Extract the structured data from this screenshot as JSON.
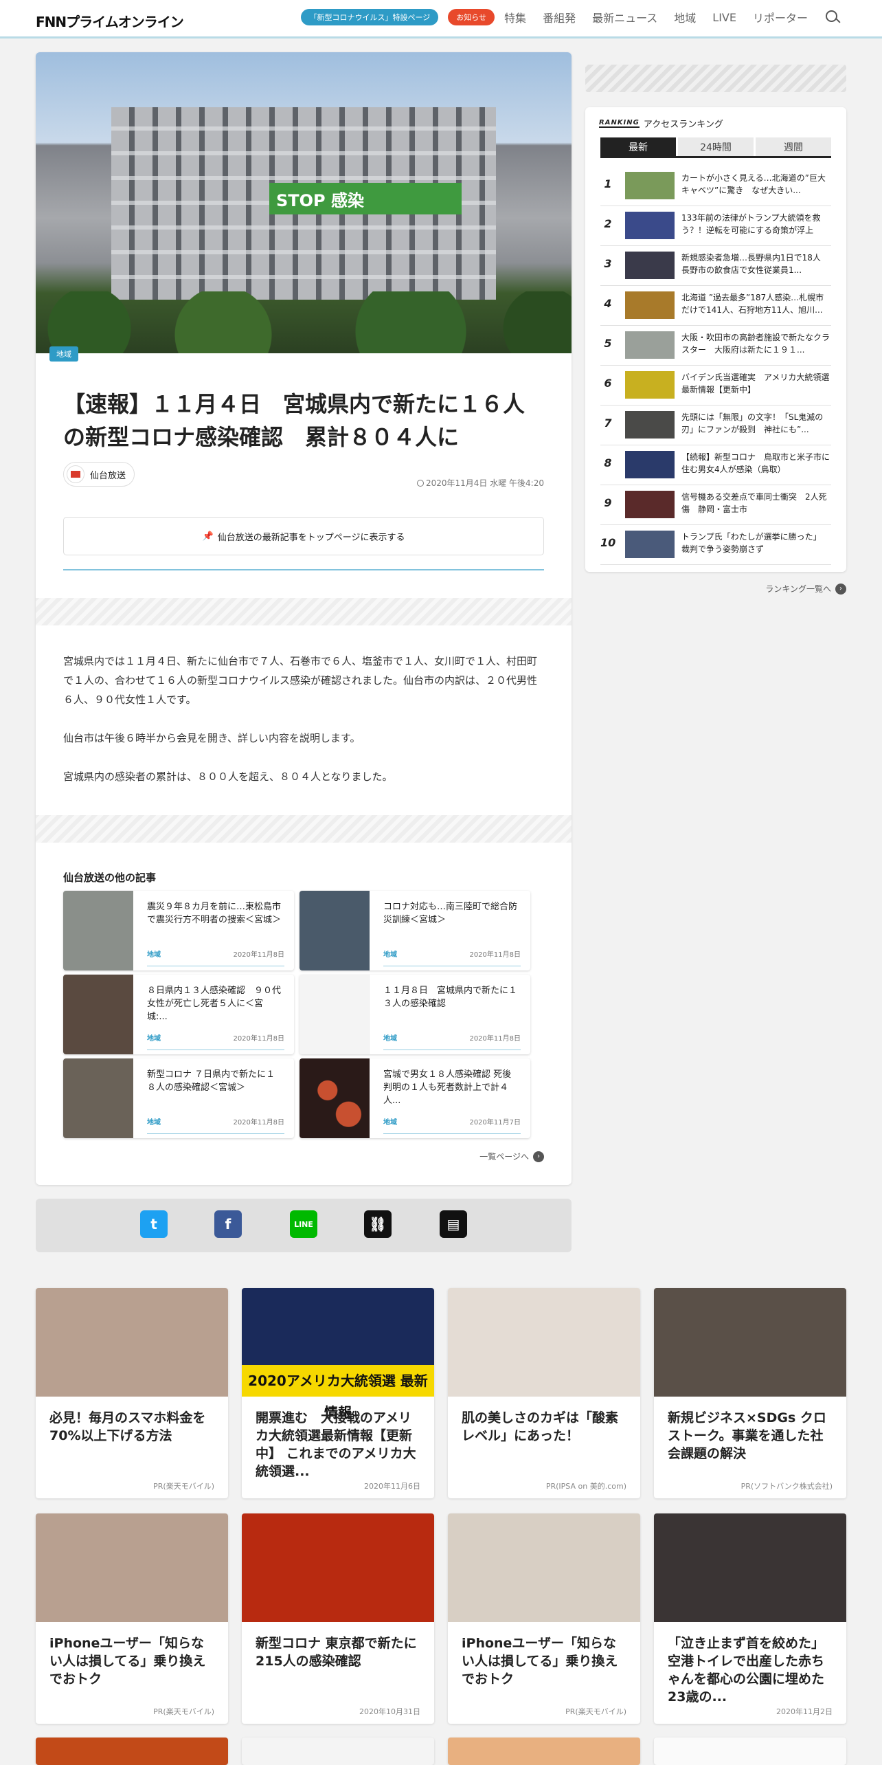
{
  "header": {
    "logo": "FNNプライムオンライン",
    "corona_pill": "「新型コロナウイルス」特設ページ",
    "notice_pill": "お知らせ",
    "nav": [
      "特集",
      "番組発",
      "最新ニュース",
      "地域",
      "LIVE",
      "リポーター"
    ]
  },
  "article": {
    "hero_banner": "STOP 感染",
    "category": "地域",
    "title": "【速報】１１月４日　宮城県内で新たに１６人の新型コロナ感染確認　累計８０４人に",
    "source": "仙台放送",
    "date": "2020年11月4日 水曜 午後4:20",
    "pin_label": "仙台放送の最新記事をトップページに表示する",
    "paragraphs": [
      "宮城県内では１１月４日、新たに仙台市で７人、石巻市で６人、塩釜市で１人、女川町で１人、村田町で１人の、合わせて１６人の新型コロナウイルス感染が確認されました。仙台市の内訳は、２０代男性６人、９０代女性１人です。",
      "仙台市は午後６時半から会見を開き、詳しい内容を説明します。",
      "宮城県内の感染者の累計は、８００人を超え、８０４人となりました。"
    ],
    "other_heading": "仙台放送の他の記事",
    "other_articles": [
      {
        "title": "震災９年８カ月を前に…東松島市で震災行方不明者の捜索＜宮城＞",
        "category": "地域",
        "date": "2020年11月8日",
        "color": "#8a8f8a"
      },
      {
        "title": "コロナ対応も…南三陸町で総合防災訓練＜宮城＞",
        "category": "地域",
        "date": "2020年11月8日",
        "color": "#4a5a6a"
      },
      {
        "title": "８日県内１３人感染確認　９０代女性が死亡し死者５人に＜宮城:...",
        "category": "地域",
        "date": "2020年11月8日",
        "color": "#5a4a40"
      },
      {
        "title": "１１月８日　宮城県内で新たに１３人の感染確認",
        "category": "地域",
        "date": "2020年11月8日",
        "color": "#ffffff"
      },
      {
        "title": "新型コロナ ７日県内で新たに１８人の感染確認＜宮城＞",
        "category": "地域",
        "date": "2020年11月8日",
        "color": "#6a6258"
      },
      {
        "title": "宮城で男女１８人感染確認 死後判明の１人も死者数計上で計４人...",
        "category": "地域",
        "date": "2020年11月7日",
        "color": "#2a1a18"
      }
    ],
    "more_label": "一覧ページへ"
  },
  "share": [
    "twitter-icon",
    "facebook-icon",
    "line-icon",
    "link-icon",
    "comment-icon"
  ],
  "ranking": {
    "brand": "RANKING",
    "title": "アクセスランキング",
    "tabs": [
      "最新",
      "24時間",
      "週間"
    ],
    "items": [
      {
        "rank": "1",
        "title": "カートが小さく見える…北海道の”巨大キャベツ”に驚き　なぜ大きい...",
        "color": "#7a9a5a"
      },
      {
        "rank": "2",
        "title": "133年前の法律がトランプ大統領を救う？！逆転を可能にする奇策が浮上",
        "color": "#3a4a8a"
      },
      {
        "rank": "3",
        "title": "新規感染者急増…長野県内1日で18人　長野市の飲食店で女性従業員1...",
        "color": "#3a3a4a"
      },
      {
        "rank": "4",
        "title": "北海道 ”過去最多”187人感染…札幌市だけで141人、石狩地方11人、旭川...",
        "color": "#a87a2a"
      },
      {
        "rank": "5",
        "title": "大阪・吹田市の高齢者施設で新たなクラスター　大阪府は新たに１９１...",
        "color": "#9aa09a"
      },
      {
        "rank": "6",
        "title": "バイデン氏当選確実　アメリカ大統領選最新情報【更新中】",
        "color": "#c8b020"
      },
      {
        "rank": "7",
        "title": "先頭には「無限」の文字！「SL鬼滅の刃」にファンが殺到　神社にも”...",
        "color": "#4a4a48"
      },
      {
        "rank": "8",
        "title": "【続報】新型コロナ　鳥取市と米子市に住む男女4人が感染（鳥取）",
        "color": "#2a3a6a"
      },
      {
        "rank": "9",
        "title": "信号機ある交差点で車同士衝突　2人死傷　静岡・富士市",
        "color": "#5a2a2a"
      },
      {
        "rank": "10",
        "title": "トランプ氏「わたしが選挙に勝った」　裁判で争う姿勢崩さず",
        "color": "#4a5a7a"
      }
    ],
    "more_label": "ランキング一覧へ"
  },
  "promos": [
    {
      "title": "必見！毎月のスマホ料金を70%以上下げる方法",
      "meta": "PR(楽天モバイル)",
      "color": "#b8a090"
    },
    {
      "title": "開票進む　大接戦のアメリカ大統領選最新情報【更新中】 これまでのアメリカ大統領選...",
      "meta": "2020年11月6日",
      "color": "#1a2a5a",
      "band": "2020アメリカ大統領選 最新情報"
    },
    {
      "title": "肌の美しさのカギは「酸素レベル」にあった！",
      "meta": "PR(IPSA on 美的.com)",
      "color": "#e4dcd4"
    },
    {
      "title": "新規ビジネス×SDGs クロストーク。事業を通した社会課題の解決",
      "meta": "PR(ソフトバンク株式会社)",
      "color": "#5a5048"
    },
    {
      "title": "iPhoneユーザー「知らない人は損してる」乗り換えでおトク",
      "meta": "PR(楽天モバイル)",
      "color": "#b8a090"
    },
    {
      "title": "新型コロナ 東京都で新たに215人の感染確認",
      "meta": "2020年10月31日",
      "color": "#b82a10"
    },
    {
      "title": "iPhoneユーザー「知らない人は損してる」乗り換えでおトク",
      "meta": "PR(楽天モバイル)",
      "color": "#d8cfc4"
    },
    {
      "title": "「泣き止まず首を絞めた」空港トイレで出産した赤ちゃんを都心の公園に埋めた23歳の...",
      "meta": "2020年11月2日",
      "color": "#3a3434"
    }
  ]
}
